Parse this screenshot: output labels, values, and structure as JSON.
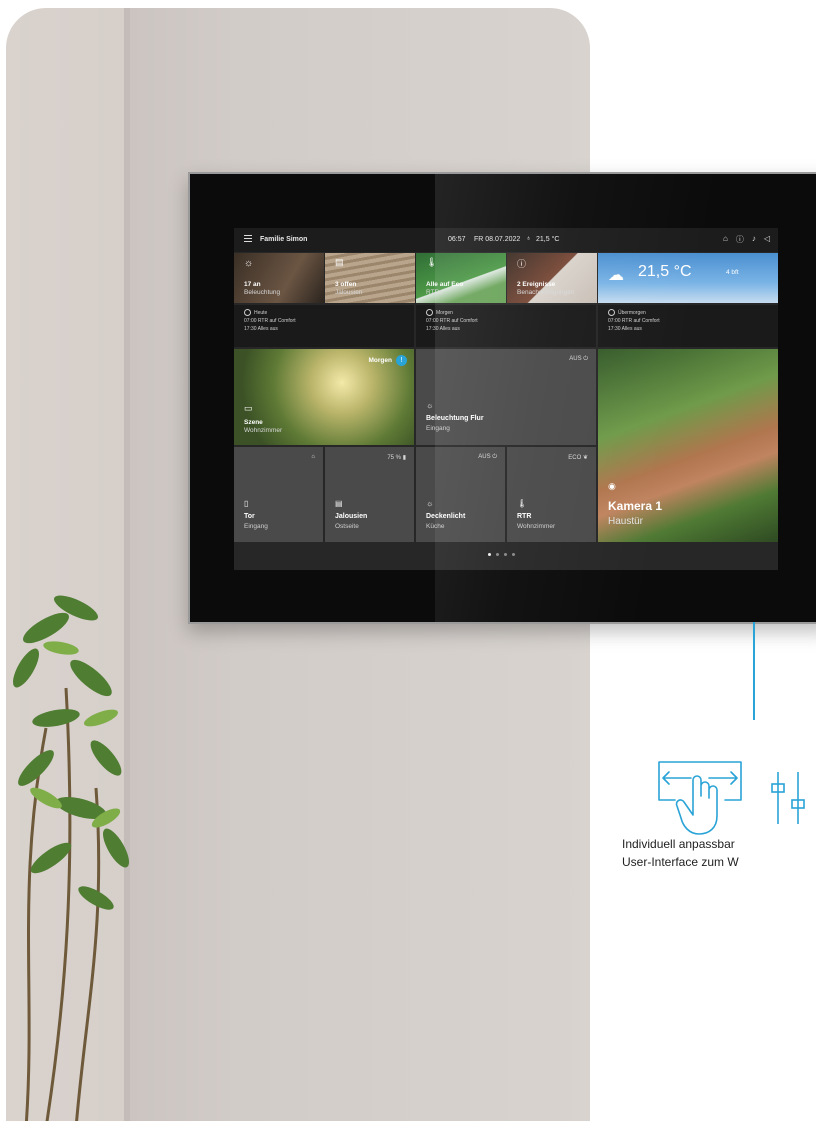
{
  "topbar": {
    "title": "Familie Simon",
    "time": "06:57",
    "date": "FR 08.07.2022",
    "temperature": "21,5 °C",
    "icons": [
      "lock-icon",
      "help-icon",
      "bell-icon",
      "speaker-icon"
    ]
  },
  "summary_cards": [
    {
      "title": "17 an",
      "subtitle": "Beleuchtung",
      "icon": "bulb-icon"
    },
    {
      "title": "3 offen",
      "subtitle": "Jalousien",
      "icon": "blind-icon"
    },
    {
      "title": "Alle auf Eco",
      "subtitle": "RTRs",
      "icon": "thermometer-icon"
    },
    {
      "title": "2 Ereignisse",
      "subtitle": "Benachrichtigungen",
      "icon": "info-icon"
    },
    {
      "title": "21,5 °C",
      "subtitle": "4 bft",
      "icon": "weather-icon"
    }
  ],
  "schedules": [
    {
      "day": "Heute",
      "lines": [
        "07:00 RTR auf Comfort",
        "17:30 Alles aus"
      ]
    },
    {
      "day": "Morgen",
      "lines": [
        "07:00 RTR auf Comfort",
        "17:30 Alles aus"
      ]
    },
    {
      "day": "Übermorgen",
      "lines": [
        "07:00 RTR auf Comfort",
        "17:30 Alles aus"
      ]
    }
  ],
  "scene": {
    "badge": "Morgen",
    "name": "Szene",
    "location": "Wohnzimmer"
  },
  "tiles": {
    "flur": {
      "state": "AUS",
      "name": "Beleuchtung Flur",
      "location": "Eingang"
    },
    "tor": {
      "state": "",
      "name": "Tor",
      "location": "Eingang"
    },
    "jalousien": {
      "state": "75 %",
      "name": "Jalousien",
      "location": "Ostseite"
    },
    "decke": {
      "state": "AUS",
      "name": "Deckenlicht",
      "location": "Küche"
    },
    "rtr": {
      "state": "ECO",
      "name": "RTR",
      "location": "Wohnzimmer"
    }
  },
  "camera": {
    "name": "Kamera 1",
    "location": "Haustür"
  },
  "pager": {
    "count": 4,
    "active": 0
  },
  "caption": {
    "line1": "Individuell anpassbar",
    "line2": "User-Interface zum W"
  },
  "colors": {
    "accent": "#2aa4d6",
    "tile": "#4a4a4a",
    "bezel": "#0b0b0b"
  }
}
